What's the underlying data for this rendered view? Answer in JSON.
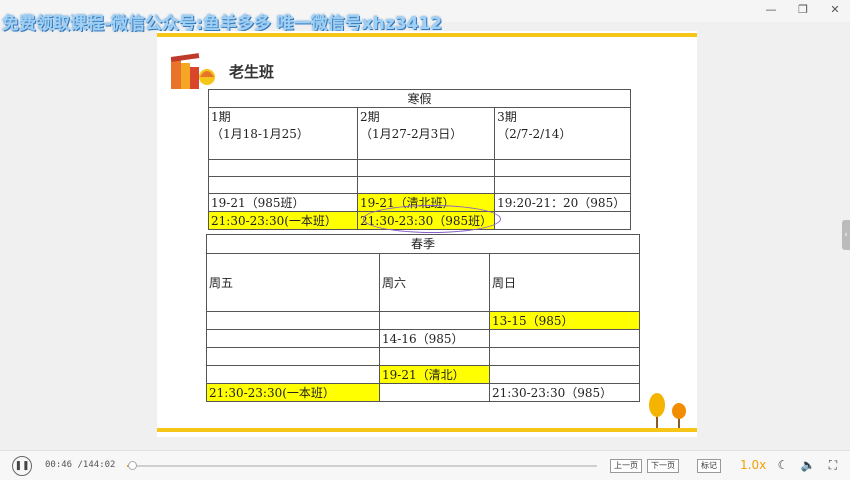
{
  "watermark": "免费领取课程-微信公众号:鱼羊多多 唯一微信号xhz3412",
  "window_controls": [
    "—",
    "❐",
    "✕"
  ],
  "slide": {
    "title": "老生班",
    "winter": {
      "header": "寒假",
      "periods": [
        {
          "label": "1期",
          "dates": "（1月18-1月25）"
        },
        {
          "label": "2期",
          "dates": "（1月27-2月3日）"
        },
        {
          "label": "3期",
          "dates": "（2/7-2/14）"
        }
      ],
      "row_a": [
        "19-21（985班）",
        "19-21（清北班）",
        "19:20-21：20（985）"
      ],
      "row_b": [
        "21:30-23:30(一本班）",
        "21:30-23:30（985班）",
        ""
      ]
    },
    "spring": {
      "header": "春季",
      "days": [
        "周五",
        "周六",
        "周日"
      ],
      "rows": [
        [
          "",
          "",
          "13-15（985）"
        ],
        [
          "",
          "14-16（985）",
          ""
        ],
        [
          "",
          "",
          ""
        ],
        [
          "",
          "19-21（清北）",
          ""
        ],
        [
          "21:30-23:30(一本班）",
          "",
          "21:30-23:30（985）"
        ]
      ]
    }
  },
  "chart_data": {
    "type": "table",
    "title": "老生班",
    "tables": [
      {
        "header": "寒假",
        "columns": [
          "1期（1月18-1月25）",
          "2期（1月27-2月3日）",
          "3期（2/7-2/14）"
        ],
        "rows": [
          [
            "19-21（985班）",
            "19-21（清北班）",
            "19:20-21：20（985）"
          ],
          [
            "21:30-23:30(一本班）",
            "21:30-23:30（985班）",
            ""
          ]
        ]
      },
      {
        "header": "春季",
        "columns": [
          "周五",
          "周六",
          "周日"
        ],
        "rows": [
          [
            "",
            "",
            "13-15（985）"
          ],
          [
            "",
            "14-16（985）",
            ""
          ],
          [
            "",
            "19-21（清北）",
            ""
          ],
          [
            "21:30-23:30(一本班）",
            "",
            "21:30-23:30（985）"
          ]
        ]
      }
    ],
    "highlight_color": "#ffff00",
    "accent_color": "#f5c518",
    "annotation_color": "#8a5fc8"
  },
  "player": {
    "current_time": "00:46",
    "total_time": "/144:02",
    "progress_fraction": 0.005,
    "prev_label": "上一页",
    "next_label": "下一页",
    "notes_label": "标记",
    "speed": "1.0x",
    "progress_color": "#f2a007"
  }
}
